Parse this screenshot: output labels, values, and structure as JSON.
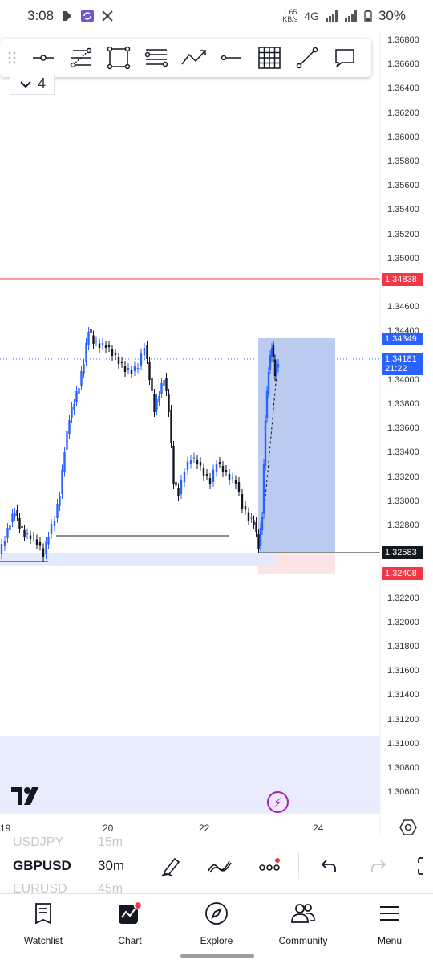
{
  "status": {
    "time": "3:08",
    "net_speed_value": "1.65",
    "net_speed_unit": "KB/s",
    "network": "4G",
    "battery": "30%"
  },
  "toolbar": {
    "count": "4",
    "tools": [
      "crosshair-line-icon",
      "fib-retracement-icon",
      "rectangle-icon",
      "fib-channel-icon",
      "path-icon",
      "horizontal-line-icon",
      "grid-icon",
      "trend-line-icon",
      "callout-icon"
    ]
  },
  "chart": {
    "price_labels": [
      "1.36800",
      "1.36600",
      "1.36400",
      "1.36200",
      "1.36000",
      "1.35800",
      "1.35600",
      "1.35400",
      "1.35200",
      "1.35000",
      "1.34600",
      "1.34400",
      "1.34000",
      "1.33800",
      "1.33600",
      "1.33400",
      "1.33200",
      "1.33000",
      "1.32800",
      "1.32200",
      "1.32000",
      "1.31800",
      "1.31600",
      "1.31400",
      "1.31200",
      "1.31000",
      "1.30800",
      "1.30600"
    ],
    "tags": {
      "stop_loss": "1.34838",
      "target": "1.34349",
      "current_price": "1.34181",
      "countdown": "21:22",
      "entry": "1.32583",
      "lower": "1.32408"
    },
    "time_labels": [
      "19",
      "20",
      "22",
      "24"
    ],
    "colors": {
      "up": "#2962ff",
      "down": "#131722",
      "stop": "#f23645",
      "target_zone": "#bccbf0"
    }
  },
  "symbols": {
    "prev": "USDJPY",
    "current": "GBPUSD",
    "next": "EURUSD",
    "prev_interval": "15m",
    "current_interval": "30m",
    "next_interval": "45m"
  },
  "nav": {
    "watchlist": "Watchlist",
    "chart": "Chart",
    "explore": "Explore",
    "community": "Community",
    "menu": "Menu"
  }
}
